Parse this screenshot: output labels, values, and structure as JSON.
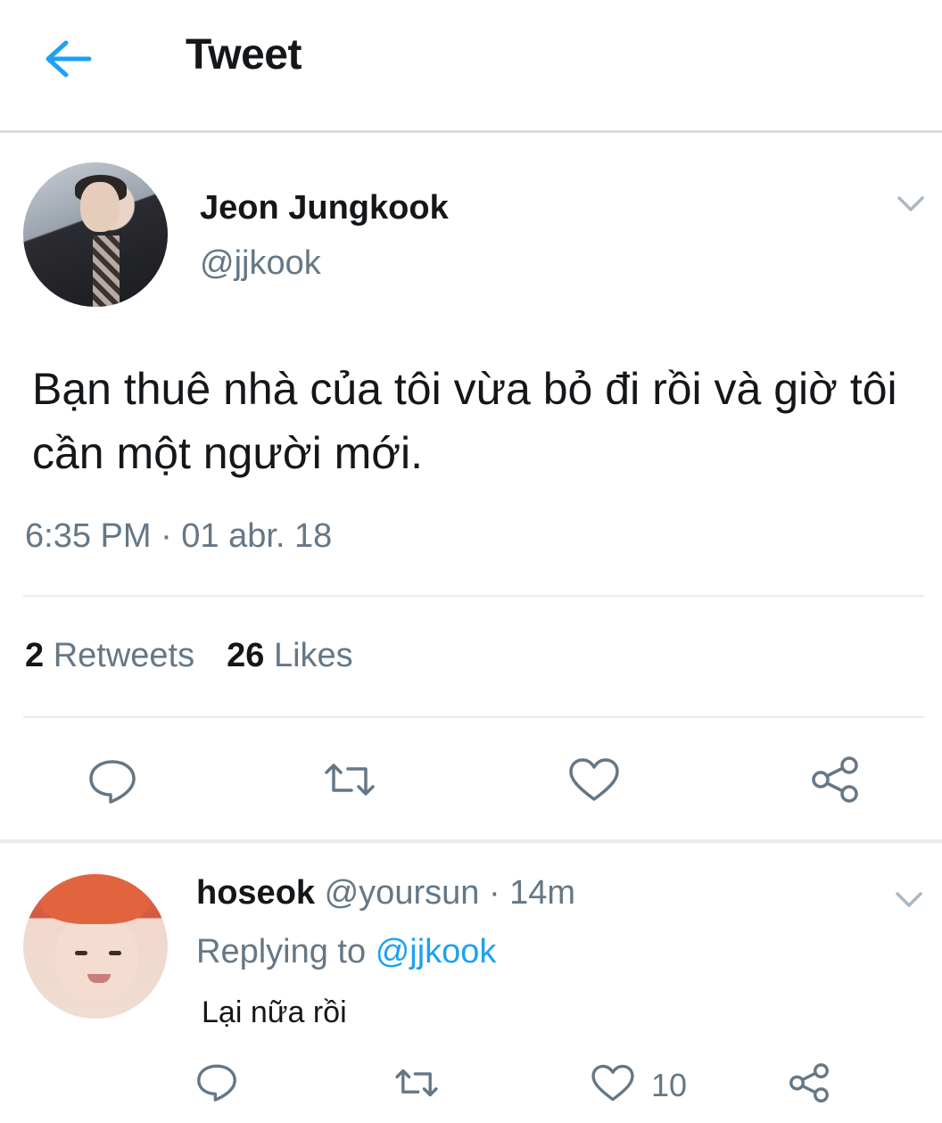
{
  "header": {
    "title": "Tweet",
    "back_icon": "back-arrow-icon",
    "accent_color": "#1da1f2"
  },
  "tweet": {
    "author_name": "Jeon Jungkook",
    "author_handle": "@jjkook",
    "text": "Bạn thuê nhà của tôi vừa bỏ đi rồi và giờ tôi cần một người mới.",
    "timestamp": "6:35 PM · 01 abr. 18",
    "retweets_count": "2",
    "retweets_label": "Retweets",
    "likes_count": "26",
    "likes_label": "Likes",
    "actions": [
      "reply-icon",
      "retweet-icon",
      "like-icon",
      "share-icon"
    ]
  },
  "reply": {
    "author_name": "hoseok",
    "author_handle": "@yoursun",
    "time": "· 14m",
    "replying_prefix": "Replying to",
    "replying_to": "@jjkook",
    "text": "Lại nữa rồi",
    "likes_count": "10"
  },
  "colors": {
    "text_primary": "#14171a",
    "text_secondary": "#657786",
    "divider": "#e6ecf0"
  }
}
